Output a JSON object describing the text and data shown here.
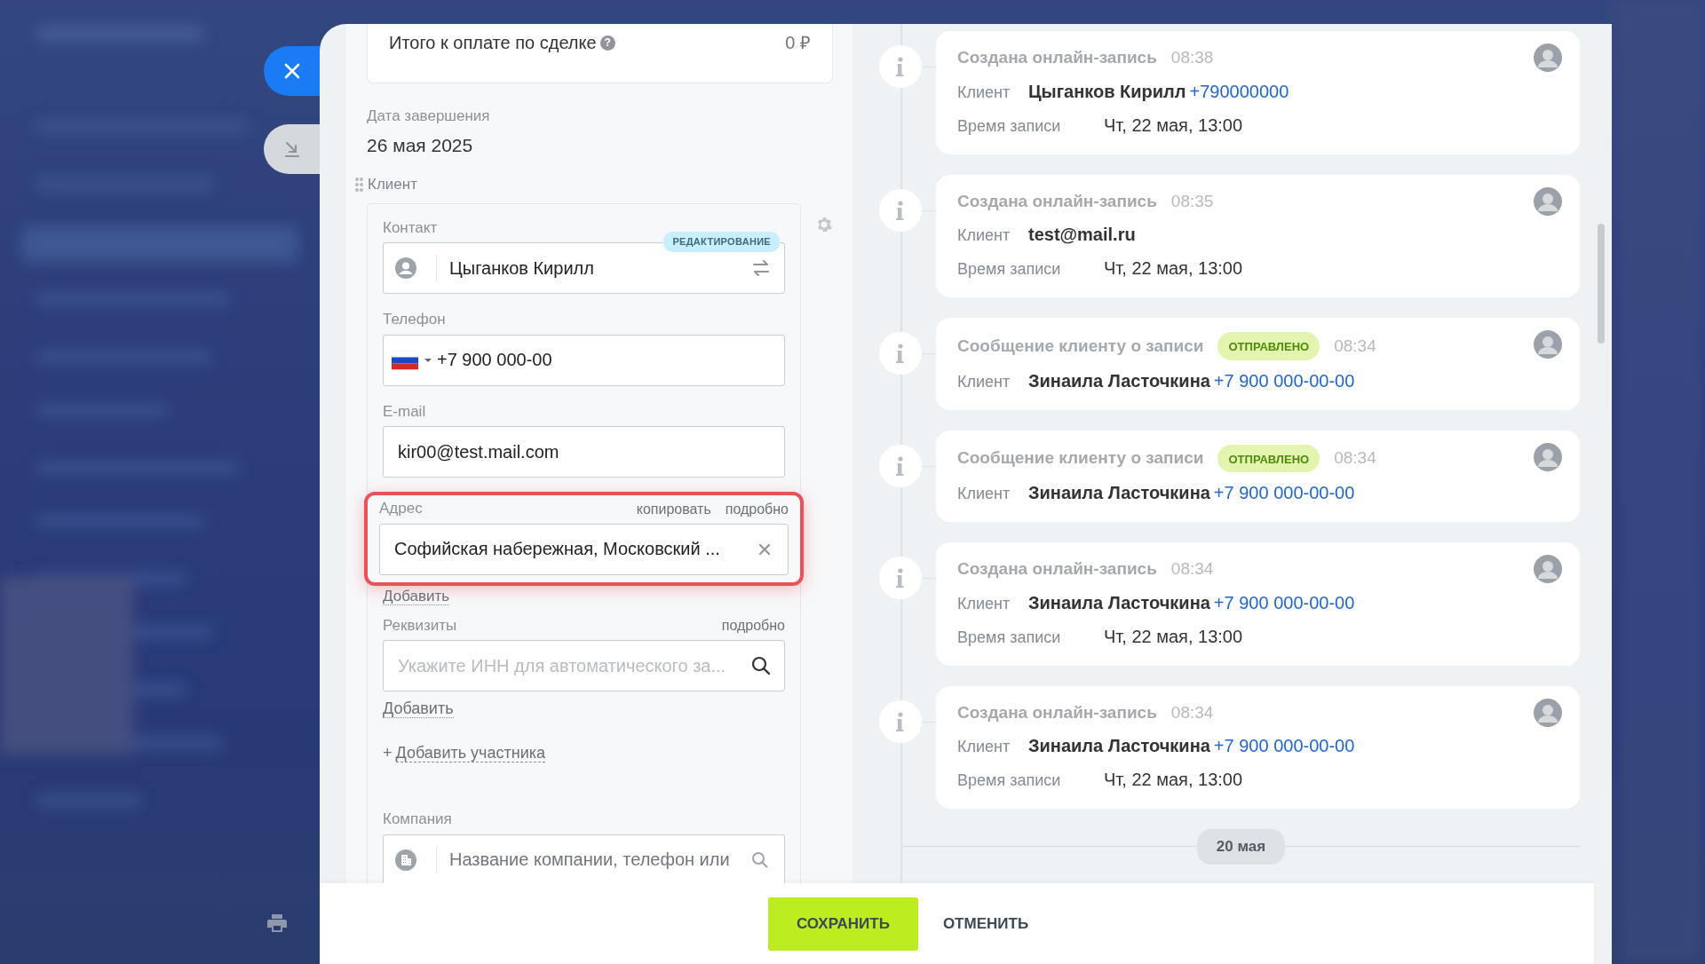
{
  "summary": {
    "label": "Итого к оплате по сделке",
    "help": "?",
    "amount": "0 ₽"
  },
  "close_date": {
    "label": "Дата завершения",
    "value": "26 мая 2025"
  },
  "client_section": {
    "title": "Клиент",
    "contact": {
      "label": "Контакт",
      "badge": "РЕДАКТИРОВАНИЕ",
      "value": "Цыганков Кирилл"
    },
    "phone": {
      "label": "Телефон",
      "value": "+7 900 000-00"
    },
    "email": {
      "label": "E-mail",
      "value": "kir00@test.mail.com"
    },
    "address": {
      "label": "Адрес",
      "actions": [
        "копировать",
        "подробно"
      ],
      "value": "Софийская набережная, Московский ...",
      "highlighted": true,
      "add": "Добавить"
    },
    "requisites": {
      "label": "Реквизиты",
      "action": "подробно",
      "placeholder": "Укажите ИНН для автоматического за...",
      "add": "Добавить"
    },
    "add_participant": {
      "icon": "+",
      "label": "Добавить участника"
    },
    "company": {
      "label": "Компания",
      "placeholder": "Название компании, телефон или"
    }
  },
  "timeline": [
    {
      "kind": "event",
      "title": "Создана онлайн-запись",
      "time": "08:38",
      "fields": [
        {
          "kind": "client",
          "label": "Клиент",
          "value": "Цыганков Кирилл",
          "link": "+790000000"
        },
        {
          "kind": "datetime",
          "label": "Время записи",
          "value": "Чт, 22 мая, 13:00"
        }
      ]
    },
    {
      "kind": "event",
      "title": "Создана онлайн-запись",
      "time": "08:35",
      "fields": [
        {
          "kind": "client",
          "label": "Клиент",
          "value": "test@mail.ru"
        },
        {
          "kind": "datetime",
          "label": "Время записи",
          "value": "Чт, 22 мая, 13:00"
        }
      ]
    },
    {
      "kind": "event",
      "title": "Сообщение клиенту о записи",
      "badge": "ОТПРАВЛЕНО",
      "time": "08:34",
      "fields": [
        {
          "kind": "client",
          "label": "Клиент",
          "value": "Зинаила Ласточкина",
          "link": "+7 900 000-00-00"
        }
      ]
    },
    {
      "kind": "event",
      "title": "Сообщение клиенту о записи",
      "badge": "ОТПРАВЛЕНО",
      "time": "08:34",
      "fields": [
        {
          "kind": "client",
          "label": "Клиент",
          "value": "Зинаила Ласточкина",
          "link": "+7 900 000-00-00"
        }
      ]
    },
    {
      "kind": "event",
      "title": "Создана онлайн-запись",
      "time": "08:34",
      "fields": [
        {
          "kind": "client",
          "label": "Клиент",
          "value": "Зинаила Ласточкина",
          "link": "+7 900 000-00-00"
        },
        {
          "kind": "datetime",
          "label": "Время записи",
          "value": "Чт, 22 мая, 13:00"
        }
      ]
    },
    {
      "kind": "event",
      "title": "Создана онлайн-запись",
      "time": "08:34",
      "fields": [
        {
          "kind": "client",
          "label": "Клиент",
          "value": "Зинаила Ласточкина",
          "link": "+7 900 000-00-00"
        },
        {
          "kind": "datetime",
          "label": "Время записи",
          "value": "Чт, 22 мая, 13:00"
        }
      ]
    },
    {
      "kind": "date",
      "label": "20 мая"
    }
  ],
  "footer": {
    "buttons": [
      {
        "kind": "primary",
        "label": "СОХРАНИТЬ"
      },
      {
        "kind": "link",
        "label": "ОТМЕНИТЬ"
      }
    ]
  }
}
